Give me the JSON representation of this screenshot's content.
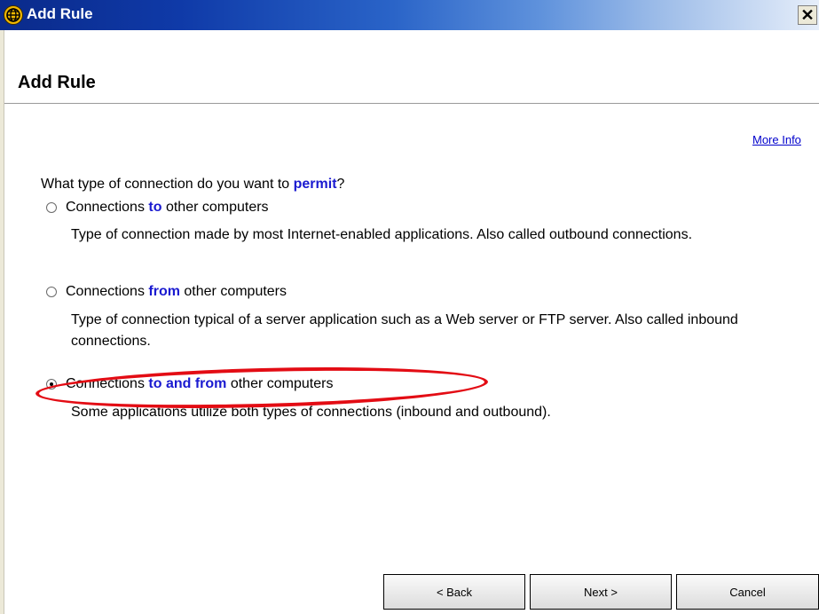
{
  "window": {
    "title": "Add Rule",
    "close_symbol": "✕"
  },
  "page": {
    "heading": "Add Rule",
    "more_info_link": "More Info"
  },
  "question": {
    "prefix": "What type of connection do you want to ",
    "keyword": "permit",
    "suffix": "?"
  },
  "options": [
    {
      "label_pre": "Connections ",
      "label_kw": "to",
      "label_post": " other computers",
      "description": "Type of connection made by most Internet-enabled applications. Also called outbound connections.",
      "selected": false
    },
    {
      "label_pre": "Connections ",
      "label_kw": "from",
      "label_post": " other computers",
      "description": "Type of connection typical of a server application such as a Web server or FTP server. Also called inbound connections.",
      "selected": false
    },
    {
      "label_pre": "Connections ",
      "label_kw": "to and from",
      "label_post": " other computers",
      "description": "Some applications utilize both types of connections (inbound and outbound).",
      "selected": true
    }
  ],
  "buttons": {
    "back_label": "< Back",
    "next_label": "Next >",
    "cancel_label": "Cancel"
  },
  "colors": {
    "title_bar": "#0f3aa8",
    "keyword": "#1a1ad0",
    "link": "#0000cc",
    "highlight": "#e30c14"
  },
  "icons": {
    "window_icon": "globe-icon",
    "close": "close-icon"
  }
}
